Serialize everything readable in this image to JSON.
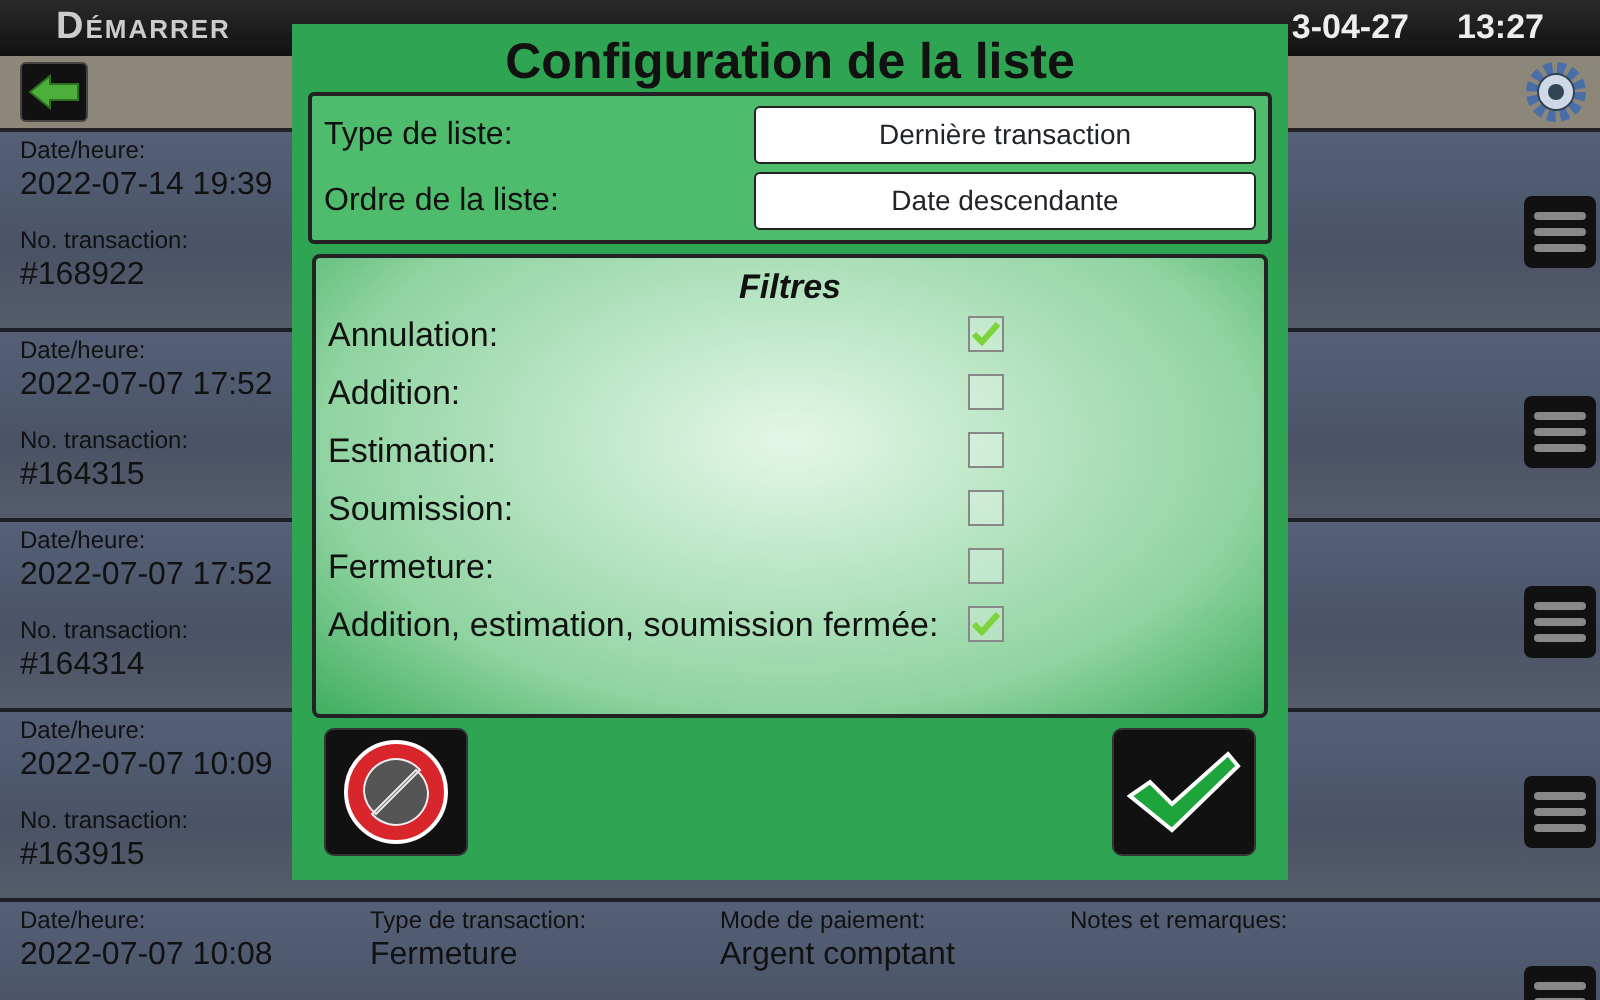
{
  "header": {
    "title": "Démarrer",
    "date_fragment": "3-04-27",
    "time": "13:27"
  },
  "rows": [
    {
      "columns": [
        [
          {
            "label": "Date/heure:",
            "value": "2022-07-14 19:39"
          },
          {
            "label": "No. transaction:",
            "value": "#168922"
          }
        ]
      ]
    },
    {
      "columns": [
        [
          {
            "label": "Date/heure:",
            "value": "2022-07-07 17:52"
          },
          {
            "label": "No. transaction:",
            "value": "#164315"
          }
        ]
      ]
    },
    {
      "columns": [
        [
          {
            "label": "Date/heure:",
            "value": "2022-07-07 17:52"
          },
          {
            "label": "No. transaction:",
            "value": "#164314"
          }
        ]
      ]
    },
    {
      "columns": [
        [
          {
            "label": "Date/heure:",
            "value": "2022-07-07 10:09"
          },
          {
            "label": "No. transaction:",
            "value": "#163915"
          }
        ]
      ]
    },
    {
      "columns": [
        [
          {
            "label": "Date/heure:",
            "value": "2022-07-07 10:08"
          }
        ],
        [
          {
            "label": "Type de transaction:",
            "value": "Fermeture"
          }
        ],
        [
          {
            "label": "Mode de paiement:",
            "value": "Argent comptant"
          }
        ],
        [
          {
            "label": "Notes et remarques:"
          }
        ]
      ]
    }
  ],
  "dialog": {
    "title": "Configuration de la liste",
    "settings": [
      {
        "label": "Type de liste:",
        "value": "Dernière transaction"
      },
      {
        "label": "Ordre de la liste:",
        "value": "Date descendante"
      }
    ],
    "filters_title": "Filtres",
    "filters": [
      {
        "label": "Annulation:",
        "checked": true
      },
      {
        "label": "Addition:",
        "checked": false
      },
      {
        "label": "Estimation:",
        "checked": false
      },
      {
        "label": "Soumission:",
        "checked": false
      },
      {
        "label": "Fermeture:",
        "checked": false
      },
      {
        "label": "Addition, estimation, soumission fermée:",
        "checked": true
      }
    ]
  }
}
